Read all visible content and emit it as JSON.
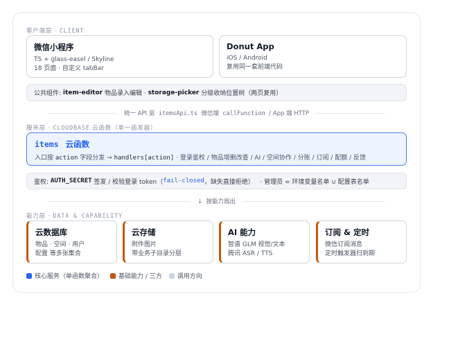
{
  "client": {
    "label_cn": "客户端层",
    "label_en": "CLIENT",
    "cards": [
      {
        "title": "微信小程序",
        "lines": [
          "TS + glass-easel / Skyline",
          "18 页面 · 自定义 tabBar"
        ]
      },
      {
        "title": "Donut App",
        "lines": [
          "iOS / Android",
          "复用同一套前端代码"
        ]
      }
    ],
    "shared": {
      "prefix": "公共组件:",
      "c1": "item-editor",
      "c1_desc": "物品录入编辑 ·",
      "c2": "storage-picker",
      "c2_desc": "分级收纳位置树（两页复用）"
    }
  },
  "api_divider": {
    "t1": "统一 API 层",
    "t2": "itemsApi.ts",
    "t3": "微信端",
    "t4": "callFunction",
    "t5": "/ App 端 HTTP"
  },
  "service": {
    "label_cn": "服务层",
    "label_en": "CLOUDBASE",
    "label_suffix": "云函数（单一函发器）",
    "items": {
      "name": "items",
      "title": "云函数",
      "desc_pre": "入口按",
      "action": "action",
      "desc_mid": "字段分发 →",
      "handlers": "handlers[action]",
      "desc_post": "·   登录鉴权 / 物品增删改查 / AI / 空间协作 / 分账 / 订阅 / 配额 / 反馈"
    },
    "auth": {
      "prefix": "鉴权:",
      "secret": "AUTH_SECRET",
      "mid": "签发 / 校验登录 token（",
      "fail": "fail-closed",
      "post": "，缺失直接拒绝）",
      "admin": "·   管理员 = 环境变量名单 ∪ 配置表名单"
    }
  },
  "capability_divider": {
    "arrow": "↓",
    "text": "按能力扇出"
  },
  "capability": {
    "label_cn": "能力层",
    "label_en": "DATA & CAPABILITY",
    "cards": [
      {
        "title": "云数据库",
        "lines": [
          "物品 · 空间 · 用户",
          "配置 等多张集合"
        ]
      },
      {
        "title": "云存储",
        "lines": [
          "附件图片",
          "带业务子目录分层"
        ]
      },
      {
        "title": "AI 能力",
        "lines": [
          "智谱 GLM 视觉/文本",
          "腾讯 ASR / TTS"
        ]
      },
      {
        "title": "订阅 & 定时",
        "lines": [
          "微信订阅消息",
          "定时触发器扫到期"
        ]
      }
    ]
  },
  "legend": [
    {
      "label": "核心服务（单函数聚合）",
      "color": "#2563eb"
    },
    {
      "label": "基础能力 / 三方",
      "color": "#c2570c"
    },
    {
      "label": "调用方向",
      "color": "#cbd5e1"
    }
  ],
  "colors": {
    "accent_blue": "#2563eb",
    "accent_orange": "#c2570c",
    "panel_bg": "#eef4ff"
  }
}
